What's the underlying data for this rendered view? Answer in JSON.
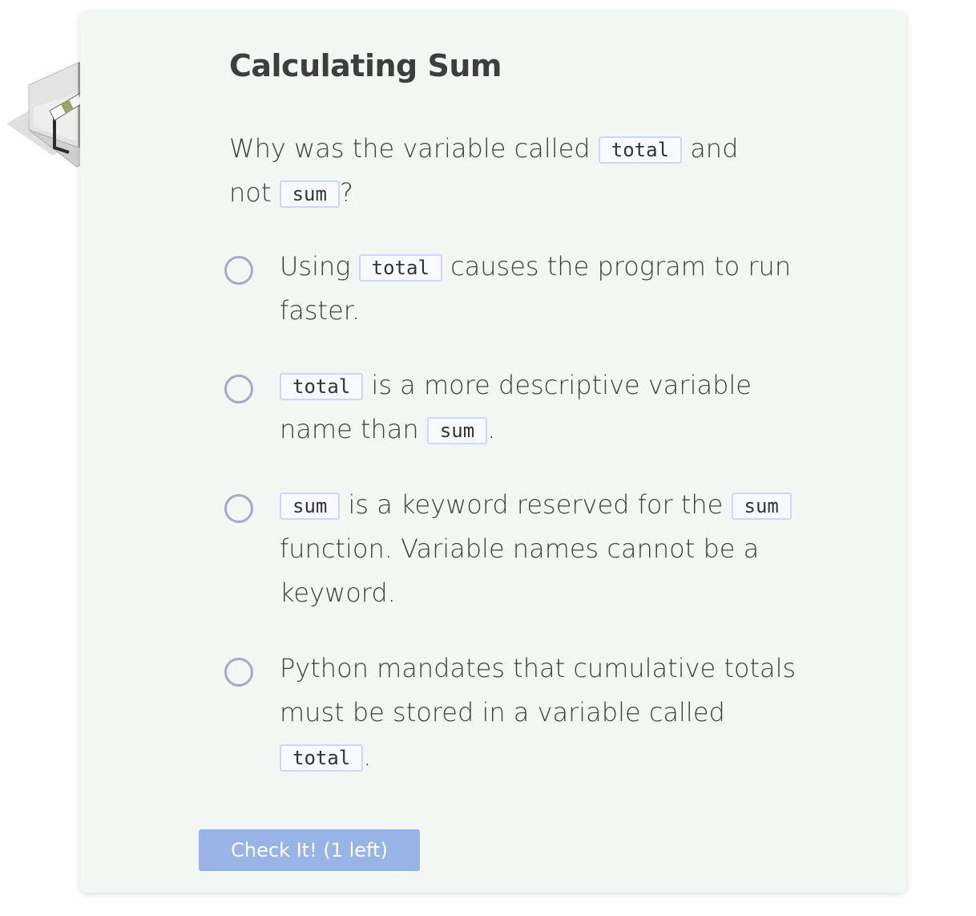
{
  "card": {
    "title": "Calculating Sum"
  },
  "question": {
    "parts": [
      "Why was the variable called ",
      "total",
      " and not ",
      "sum",
      "?"
    ]
  },
  "options": [
    {
      "parts": [
        "Using ",
        "total",
        " causes the program to run faster."
      ]
    },
    {
      "parts": [
        "total",
        " is a more descriptive variable name than ",
        "sum",
        "."
      ]
    },
    {
      "parts": [
        "sum",
        " is a keyword reserved for the ",
        "sum",
        " function. Variable names cannot be a keyword."
      ]
    },
    {
      "parts": [
        "Python mandates that cumulative totals must be stored in a variable called ",
        "total",
        "."
      ]
    }
  ],
  "button": {
    "label": "Check It! (1 left)"
  },
  "icons": {
    "badge": "hurdle-badge-icon",
    "radio": "radio-unchecked"
  },
  "colors": {
    "card_background": "#f3f7f4",
    "button_background": "#98b3e6",
    "code_border": "#cfd8ee",
    "radio_border": "#a8abbc"
  }
}
